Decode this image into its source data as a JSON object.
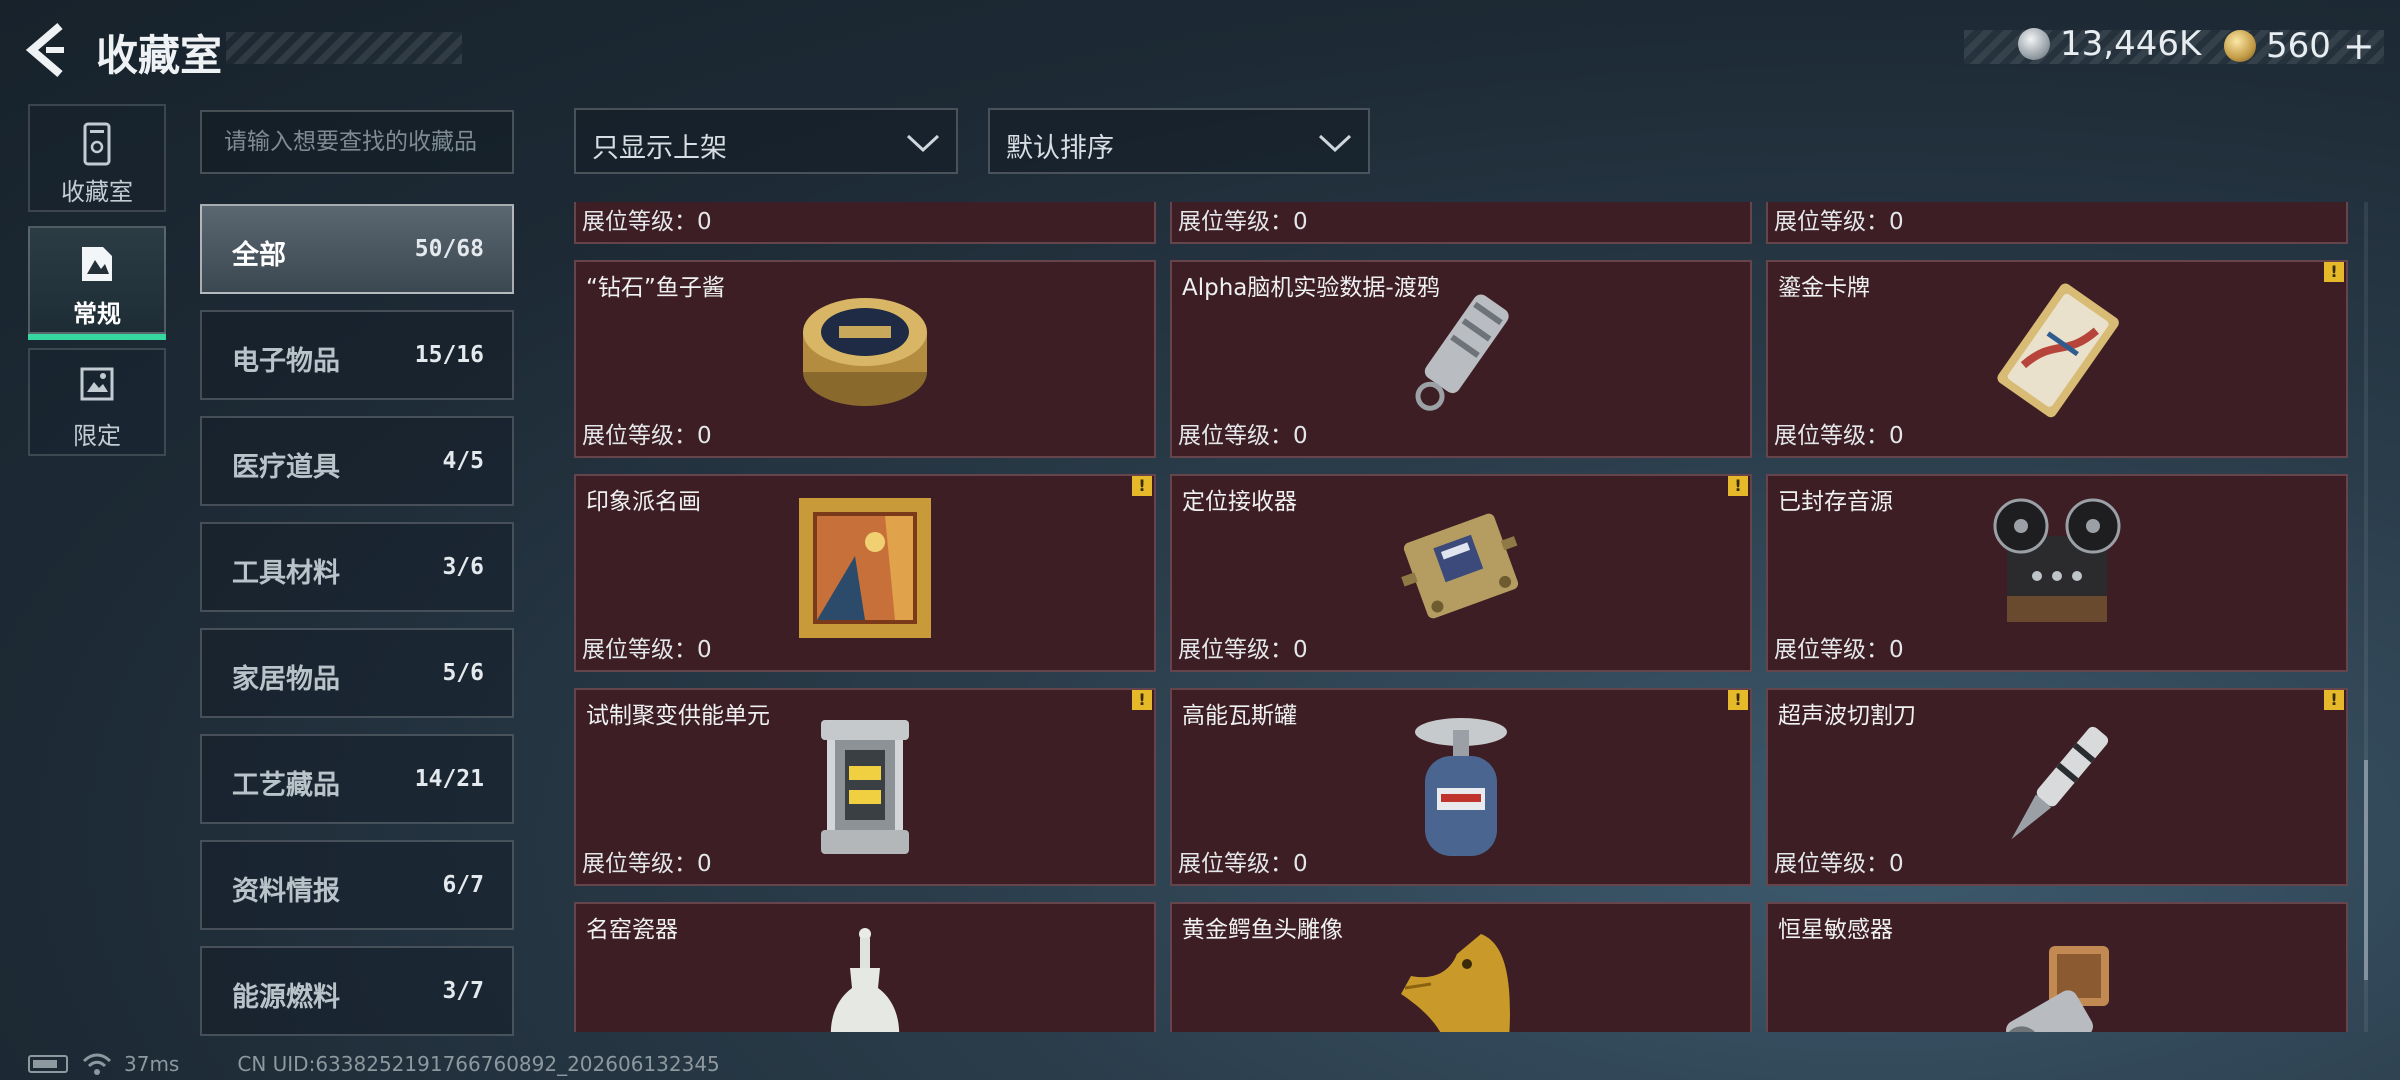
{
  "header": {
    "title": "收藏室",
    "currency_silver": "13,446K",
    "currency_gold": "560",
    "plus": "+"
  },
  "modes": [
    {
      "label": "收藏室",
      "icon": "collection-room-icon"
    },
    {
      "label": "常规",
      "icon": "regular-icon"
    },
    {
      "label": "限定",
      "icon": "limited-icon"
    }
  ],
  "search": {
    "placeholder": "请输入想要查找的收藏品"
  },
  "categories": [
    {
      "name": "全部",
      "count": "50/68"
    },
    {
      "name": "电子物品",
      "count": "15/16"
    },
    {
      "name": "医疗道具",
      "count": "4/5"
    },
    {
      "name": "工具材料",
      "count": "3/6"
    },
    {
      "name": "家居物品",
      "count": "5/6"
    },
    {
      "name": "工艺藏品",
      "count": "14/21"
    },
    {
      "name": "资料情报",
      "count": "6/7"
    },
    {
      "name": "能源燃料",
      "count": "3/7"
    }
  ],
  "filters": {
    "shelf": "只显示上架",
    "sort": "默认排序"
  },
  "items": [
    {
      "name": "",
      "level": "展位等级：0",
      "warn": false,
      "icon": "partial-item-icon"
    },
    {
      "name": "",
      "level": "展位等级：0",
      "warn": false,
      "icon": "partial-item-icon"
    },
    {
      "name": "",
      "level": "展位等级：0",
      "warn": false,
      "icon": "partial-item-icon"
    },
    {
      "name": "“钻石”鱼子酱",
      "level": "展位等级：0",
      "warn": false,
      "icon": "caviar-tin-icon"
    },
    {
      "name": "Alpha脑机实验数据-渡鸦",
      "level": "展位等级：0",
      "warn": false,
      "icon": "data-drive-icon"
    },
    {
      "name": "鎏金卡牌",
      "level": "展位等级：0",
      "warn": true,
      "icon": "gilded-card-icon"
    },
    {
      "name": "印象派名画",
      "level": "展位等级：0",
      "warn": true,
      "icon": "painting-icon"
    },
    {
      "name": "定位接收器",
      "level": "展位等级：0",
      "warn": true,
      "icon": "receiver-icon"
    },
    {
      "name": "已封存音源",
      "level": "展位等级：0",
      "warn": false,
      "icon": "tape-recorder-icon"
    },
    {
      "name": "试制聚变供能单元",
      "level": "展位等级：0",
      "warn": true,
      "icon": "fusion-cell-icon"
    },
    {
      "name": "高能瓦斯罐",
      "level": "展位等级：0",
      "warn": true,
      "icon": "gas-canister-icon"
    },
    {
      "name": "超声波切割刀",
      "level": "展位等级：0",
      "warn": true,
      "icon": "ultrasonic-knife-icon"
    },
    {
      "name": "名窑瓷器",
      "level": "",
      "warn": false,
      "icon": "porcelain-vase-icon"
    },
    {
      "name": "黄金鳄鱼头雕像",
      "level": "",
      "warn": false,
      "icon": "gold-crocodile-icon"
    },
    {
      "name": "恒星敏感器",
      "level": "",
      "warn": false,
      "icon": "star-sensor-icon"
    }
  ],
  "status": {
    "ping": "37ms",
    "uid": "CN UID:6338252191766760892_202606132345"
  }
}
